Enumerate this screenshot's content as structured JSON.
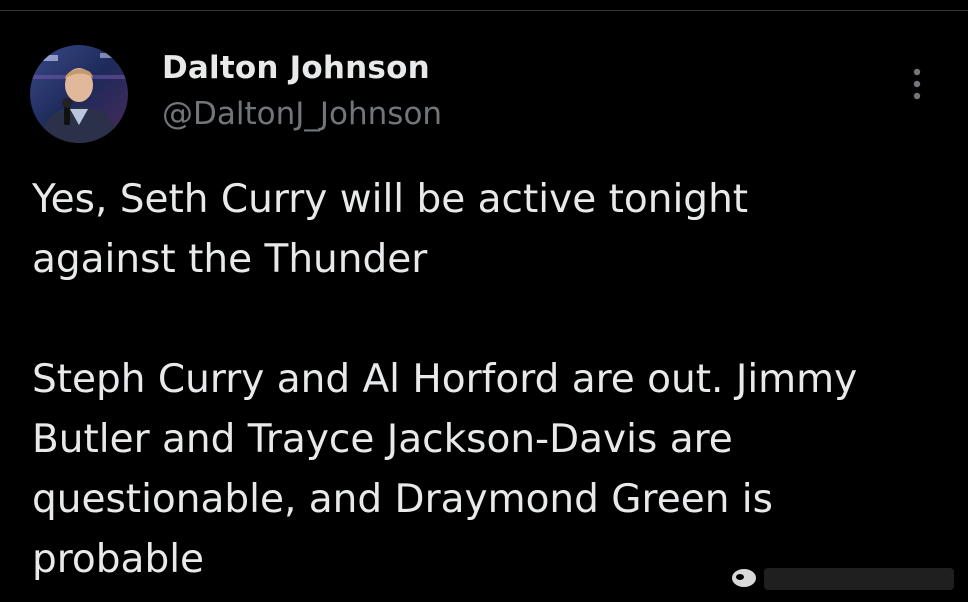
{
  "author": {
    "display_name": "Dalton Johnson",
    "handle": "@DaltonJ_Johnson",
    "avatar_icon": "profile-photo"
  },
  "tweet": {
    "text": "Yes, Seth Curry will be active tonight\nagainst the Thunder\n\nSteph Curry and Al Horford are out. Jimmy\nButler and Trayce Jackson-Davis are\nquestionable, and Draymond Green is\nprobable"
  },
  "more_menu": {
    "icon": "more-vertical-icon"
  },
  "colors": {
    "background": "#000000",
    "primary_text": "#e7e9ea",
    "secondary_text": "#71767b",
    "divider": "#2f3336"
  }
}
